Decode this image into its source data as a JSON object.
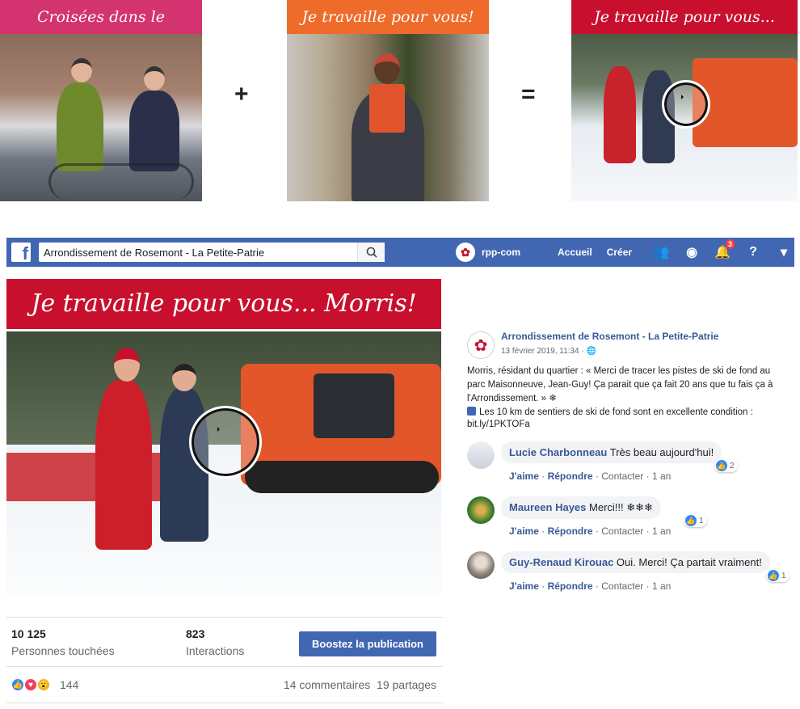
{
  "banners": [
    {
      "title": "Croisées dans le quartier!",
      "color": "#d3336e"
    },
    {
      "title": "Je travaille pour vous!",
      "color": "#ee6b2a"
    },
    {
      "title": "Je travaille pour vous... Morris!",
      "color": "#c8102e"
    }
  ],
  "operators": {
    "plus": "+",
    "equals": "="
  },
  "fb": {
    "search_value": "Arrondissement de Rosemont - La Petite-Patrie",
    "page_handle": "rpp-com",
    "nav_home": "Accueil",
    "nav_create": "Créer",
    "notif_count": "3",
    "brand_color": "#4267b2"
  },
  "post": {
    "banner_title": "Je travaille pour vous... Morris!",
    "stats": {
      "reach": "10 125",
      "reach_label": "Personnes touchées",
      "interactions": "823",
      "interactions_label": "Interactions",
      "boost_label": "Boostez la publication"
    },
    "reactions_count": "144",
    "comments_count": "14 commentaires",
    "shares_count": "19 partages"
  },
  "sidebar": {
    "page_name": "Arrondissement de Rosemont - La Petite-Patrie",
    "timestamp": "13 février 2019, 11:34 · ",
    "text": "Morris, résidant du quartier : « Merci de tracer les pistes de ski de fond au parc Maisonneuve, Jean-Guy! Ça parait que ça fait 20 ans que tu fais ça à l'Arrondissement. » ❄",
    "link_text": "Les 10 km de sentiers de ski de fond sont en excellente condition : bit.ly/1PKTOFa",
    "comments": [
      {
        "author": "Lucie Charbonneau",
        "text": "Très beau aujourd'hui!",
        "like": "J'aime",
        "reply": "Répondre",
        "contact": "Contacter",
        "time": "1 an",
        "reacts": "2"
      },
      {
        "author": "Maureen Hayes",
        "text": "Merci!!! ❄❄❄",
        "like": "J'aime",
        "reply": "Répondre",
        "contact": "Contacter",
        "time": "1 an",
        "reacts": "1"
      },
      {
        "author": "Guy-Renaud Kirouac",
        "text": "Oui. Merci! Ça partait vraiment!",
        "like": "J'aime",
        "reply": "Répondre",
        "contact": "Contacter",
        "time": "1 an",
        "reacts": "1"
      }
    ]
  }
}
